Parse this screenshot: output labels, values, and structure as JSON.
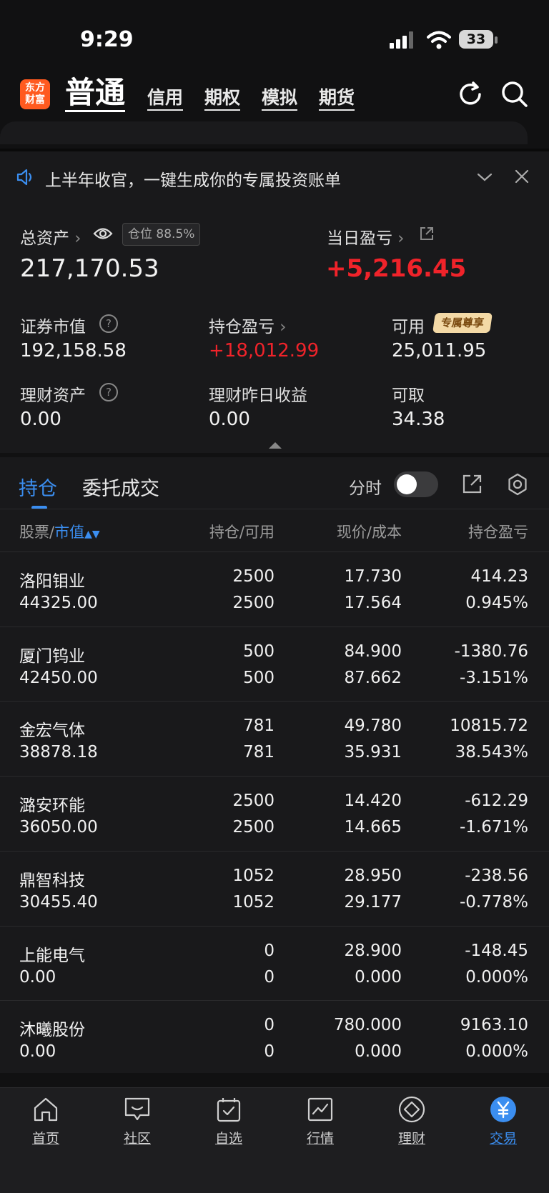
{
  "status_bar": {
    "time": "9:29",
    "battery": "33"
  },
  "header": {
    "logo": "东方财富",
    "active_tab": "普通",
    "tabs": [
      "信用",
      "期权",
      "模拟",
      "期货"
    ]
  },
  "notice": {
    "text": "上半年收官，一键生成你的专属投资账单"
  },
  "summary": {
    "total_assets_label": "总资产",
    "position_ratio": "仓位 88.5%",
    "total_assets": "217,170.53",
    "daily_pnl_label": "当日盈亏",
    "daily_pnl": "+5,216.45",
    "securities_value_label": "证券市值",
    "securities_value": "192,158.58",
    "holding_pnl_label": "持仓盈亏",
    "holding_pnl": "+18,012.99",
    "available_label": "可用",
    "exclusive_badge": "专属尊享",
    "available": "25,011.95",
    "wealth_assets_label": "理财资产",
    "wealth_assets": "0.00",
    "wealth_yesterday_label": "理财昨日收益",
    "wealth_yesterday": "0.00",
    "withdrawable_label": "可取",
    "withdrawable": "34.38"
  },
  "holdings": {
    "tab_positions": "持仓",
    "tab_orders": "委托成交",
    "timeshare_label": "分时",
    "columns": {
      "stock": "股票",
      "sort_field": "市值",
      "holding_available": "持仓/可用",
      "price_cost": "现价/成本",
      "holding_pnl": "持仓盈亏"
    },
    "rows": [
      {
        "name": "洛阳钼业",
        "market_value": "44325.00",
        "qty": "2500",
        "available": "2500",
        "price": "17.730",
        "cost": "17.564",
        "pnl": "414.23",
        "pct": "0.945%",
        "dir": "up"
      },
      {
        "name": "厦门钨业",
        "market_value": "42450.00",
        "qty": "500",
        "available": "500",
        "price": "84.900",
        "cost": "87.662",
        "pnl": "-1380.76",
        "pct": "-3.151%",
        "dir": "down"
      },
      {
        "name": "金宏气体",
        "market_value": "38878.18",
        "qty": "781",
        "available": "781",
        "price": "49.780",
        "cost": "35.931",
        "pnl": "10815.72",
        "pct": "38.543%",
        "dir": "up"
      },
      {
        "name": "潞安环能",
        "market_value": "36050.00",
        "qty": "2500",
        "available": "2500",
        "price": "14.420",
        "cost": "14.665",
        "pnl": "-612.29",
        "pct": "-1.671%",
        "dir": "down"
      },
      {
        "name": "鼎智科技",
        "market_value": "30455.40",
        "qty": "1052",
        "available": "1052",
        "price": "28.950",
        "cost": "29.177",
        "pnl": "-238.56",
        "pct": "-0.778%",
        "dir": "down"
      },
      {
        "name": "上能电气",
        "market_value": "0.00",
        "qty": "0",
        "available": "0",
        "price": "28.900",
        "cost": "0.000",
        "pnl": "-148.45",
        "pct": "0.000%",
        "dir": "down"
      },
      {
        "name": "沐曦股份",
        "market_value": "0.00",
        "qty": "0",
        "available": "0",
        "price": "780.000",
        "cost": "0.000",
        "pnl": "9163.10",
        "pct": "0.000%",
        "dir": "up"
      }
    ]
  },
  "bottom_nav": [
    {
      "label": "首页",
      "icon": "home-icon"
    },
    {
      "label": "社区",
      "icon": "community-icon"
    },
    {
      "label": "自选",
      "icon": "watchlist-icon"
    },
    {
      "label": "行情",
      "icon": "market-icon"
    },
    {
      "label": "理财",
      "icon": "wealth-icon"
    },
    {
      "label": "交易",
      "icon": "trade-icon",
      "active": true
    }
  ],
  "colors": {
    "up": "#f0232a",
    "down": "#23c523",
    "accent": "#3b8ef0"
  }
}
